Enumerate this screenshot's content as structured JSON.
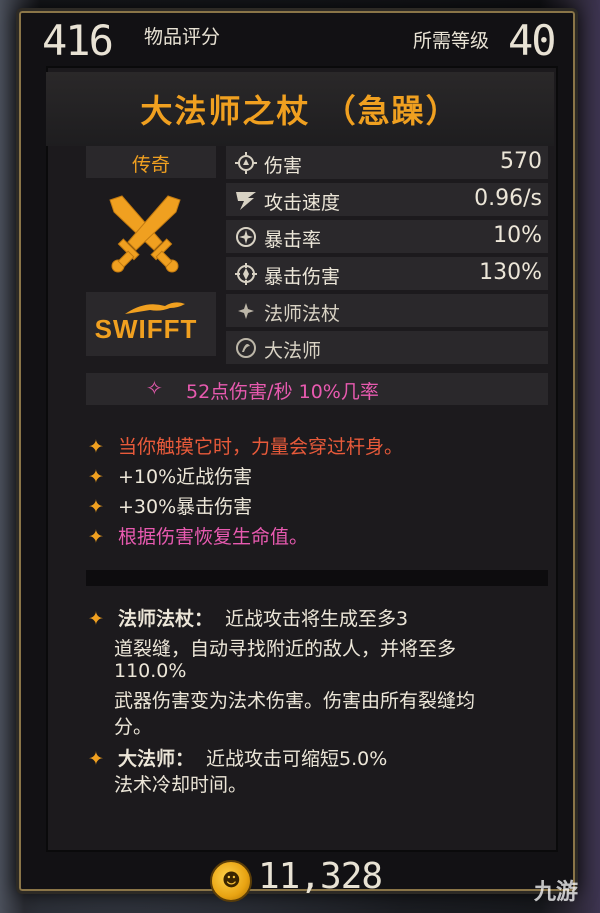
{
  "header": {
    "item_score": "416",
    "item_score_label": "物品评分",
    "level_label": "所需等级",
    "level": "40"
  },
  "item": {
    "title": "大法师之杖 （急躁）",
    "rarity": "传奇",
    "brand": "SWIFFT"
  },
  "stats": [
    {
      "icon": "damage-icon",
      "label": "伤害",
      "value": "570"
    },
    {
      "icon": "attack-speed-icon",
      "label": "攻击速度",
      "value": "0.96/s"
    },
    {
      "icon": "crit-rate-icon",
      "label": "暴击率",
      "value": "10%"
    },
    {
      "icon": "crit-damage-icon",
      "label": "暴击伤害",
      "value": "130%"
    },
    {
      "icon": "sparkle-icon",
      "label": "法师法杖",
      "value": ""
    },
    {
      "icon": "archmage-class-icon",
      "label": "大法师",
      "value": ""
    }
  ],
  "dps": {
    "text": "52点伤害/秒  10%几率"
  },
  "affixes": [
    {
      "text": "当你触摸它时，力量会穿过杆身。",
      "color": "#e85a3a"
    },
    {
      "text": "+10%近战伤害",
      "color": "#ece6d8"
    },
    {
      "text": "+30%暴击伤害",
      "color": "#ece6d8"
    },
    {
      "text": "根据伤害恢复生命值。",
      "color": "#e85ab0"
    }
  ],
  "passives": [
    {
      "name": "法师法杖：",
      "lines": [
        "近战攻击将生成至多3",
        "道裂缝，自动寻找附近的敌人，并将至多",
        "110.0%",
        "武器伤害变为法术伤害。伤害由所有裂缝均",
        "分。"
      ]
    },
    {
      "name": "大法师：",
      "lines": [
        "近战攻击可缩短5.0%",
        "法术冷却时间。"
      ]
    }
  ],
  "footer": {
    "price": "11,328"
  },
  "watermark": "九游",
  "colors": {
    "legendary": "#f0a020",
    "frame": "#8a7548",
    "pink": "#e85ab0",
    "red": "#e85a3a"
  }
}
